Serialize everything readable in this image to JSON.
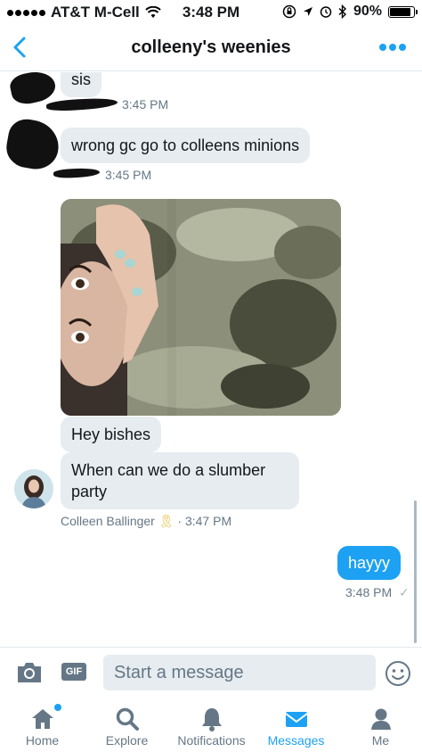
{
  "status_bar": {
    "carrier": "AT&T M-Cell",
    "time": "3:48 PM",
    "battery": "90%",
    "battery_level": 0.9
  },
  "nav": {
    "title": "colleeny's weenies",
    "back_icon": "chevron-left-icon",
    "more_icon": "more-dots-icon"
  },
  "messages": [
    {
      "text": "sis",
      "time": "3:45 PM"
    },
    {
      "text": "wrong gc go to colleens minions",
      "time": "3:45 PM"
    },
    {
      "text": "Hey bishes"
    },
    {
      "text": "When can we do a slumber party",
      "sender": "Colleen Ballinger",
      "sender_badge": "🎗",
      "time": "3:47 PM"
    }
  ],
  "outgoing": {
    "text": "hayyy",
    "time": "3:48 PM",
    "check": "✓"
  },
  "composer": {
    "placeholder": "Start a message",
    "gif_label": "GIF"
  },
  "tabs": [
    {
      "label": "Home",
      "icon": "home-icon",
      "active": false,
      "badge": true
    },
    {
      "label": "Explore",
      "icon": "search-icon",
      "active": false
    },
    {
      "label": "Notifications",
      "icon": "bell-icon",
      "active": false
    },
    {
      "label": "Messages",
      "icon": "envelope-icon",
      "active": true
    },
    {
      "label": "Me",
      "icon": "person-icon",
      "active": false
    }
  ],
  "colors": {
    "accent": "#1da1f2",
    "bubble": "#e6ecf0",
    "meta": "#657786"
  }
}
